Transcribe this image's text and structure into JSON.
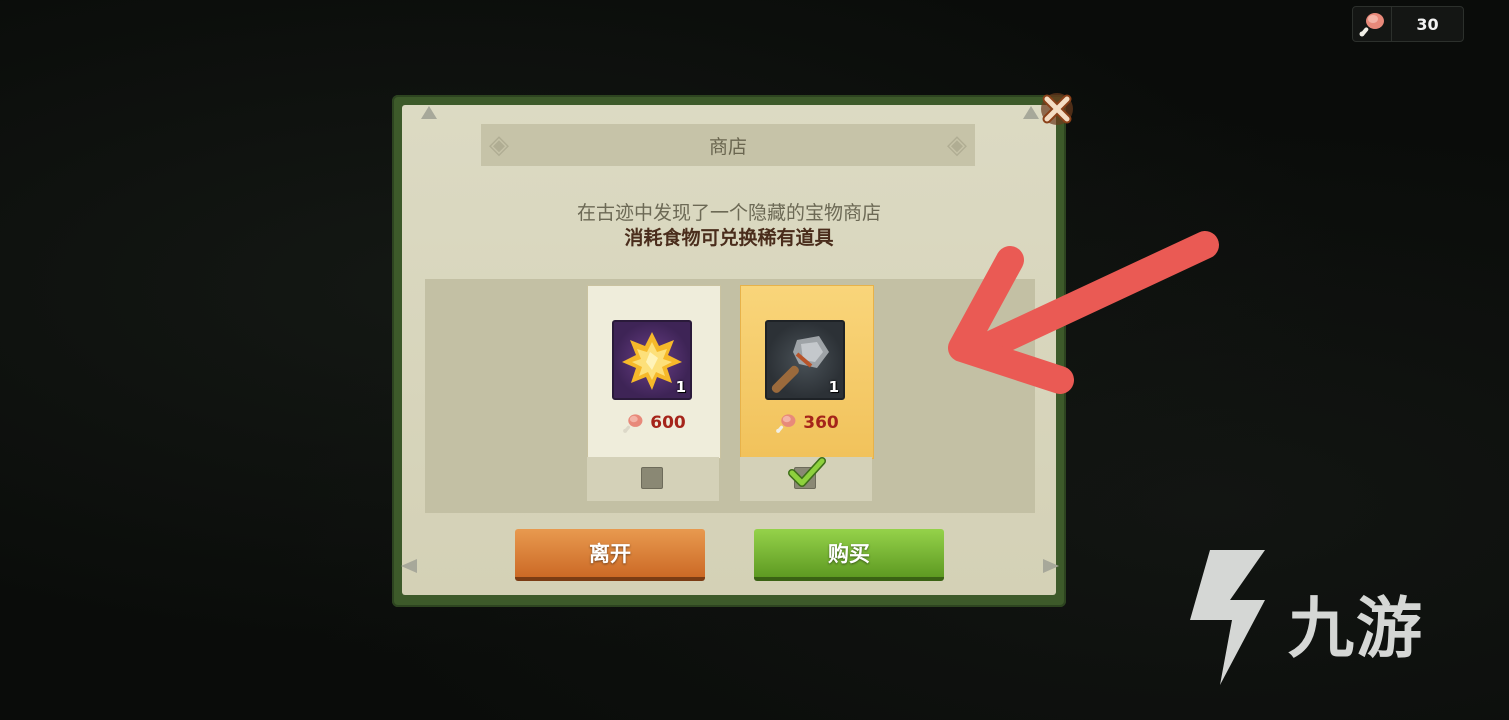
{
  "hud": {
    "food_icon": "meat-drumstick-icon",
    "food_count": "30"
  },
  "dialog": {
    "title": "商店",
    "description_line1": "在古迹中发现了一个隐藏的宝物商店",
    "description_line2": "消耗食物可兑换稀有道具",
    "close_icon": "close-x-icon",
    "items": [
      {
        "icon": "gold-gem-cluster-icon",
        "quantity": "1",
        "price": "600",
        "price_icon": "meat-drumstick-icon",
        "selected": false
      },
      {
        "icon": "stone-hammer-icon",
        "quantity": "1",
        "price": "360",
        "price_icon": "meat-drumstick-icon",
        "selected": true
      }
    ],
    "leave_label": "离开",
    "buy_label": "购买"
  },
  "colors": {
    "frame_green": "#3d5a2a",
    "paper": "#dcdac3",
    "leave_orange": "#cc6a26",
    "buy_green": "#5e9a22",
    "price_red": "#a5241a",
    "selected_gold": "#f1c25b",
    "annotation_red": "#ea5a54"
  },
  "watermark": {
    "text": "九游"
  }
}
